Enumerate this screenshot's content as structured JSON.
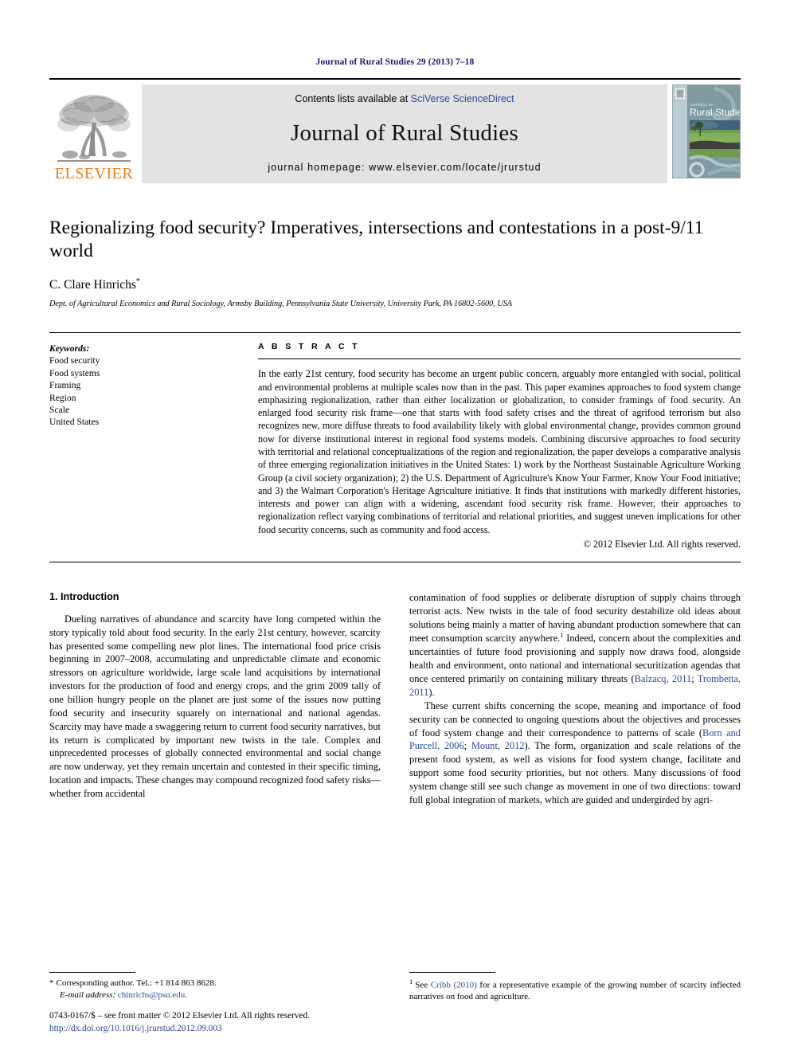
{
  "running_head": "Journal of Rural Studies 29 (2013) 7–18",
  "banner": {
    "publisher_name": "ELSEVIER",
    "contents_prefix": "Contents lists available at ",
    "contents_link": "SciVerse ScienceDirect",
    "journal_title": "Journal of Rural Studies",
    "homepage": "journal homepage: www.elsevier.com/locate/jrurstud",
    "cover": {
      "kicker": "JOURNAL OF",
      "title": "Rural Studies"
    },
    "colors": {
      "elsevier_orange": "#f07d20",
      "link_blue": "#2b4a9b",
      "panel_gray": "#e3e3e3",
      "cover_teal": "#6f8d94"
    }
  },
  "article": {
    "title": "Regionalizing food security? Imperatives, intersections and contestations in a post-9/11 world",
    "author": "C. Clare Hinrichs",
    "author_marker": "*",
    "affiliation": "Dept. of Agricultural Economics and Rural Sociology, Armsby Building, Pennsylvania State University, University Park, PA 16802-5600, USA"
  },
  "keywords": {
    "heading": "Keywords:",
    "items": [
      "Food security",
      "Food systems",
      "Framing",
      "Region",
      "Scale",
      "United States"
    ]
  },
  "abstract": {
    "heading": "A B S T R A C T",
    "text": "In the early 21st century, food security has become an urgent public concern, arguably more entangled with social, political and environmental problems at multiple scales now than in the past. This paper examines approaches to food system change emphasizing regionalization, rather than either localization or globalization, to consider framings of food security. An enlarged food security risk frame—one that starts with food safety crises and the threat of agrifood terrorism but also recognizes new, more diffuse threats to food availability likely with global environmental change, provides common ground now for diverse institutional interest in regional food systems models. Combining discursive approaches to food security with territorial and relational conceptualizations of the region and regionalization, the paper develops a comparative analysis of three emerging regionalization initiatives in the United States: 1) work by the Northeast Sustainable Agriculture Working Group (a civil society organization); 2) the U.S. Department of Agriculture's Know Your Farmer, Know Your Food initiative; and 3) the Walmart Corporation's Heritage Agriculture initiative. It finds that institutions with markedly different histories, interests and power can align with a widening, ascendant food security risk frame. However, their approaches to regionalization reflect varying combinations of territorial and relational priorities, and suggest uneven implications for other food security concerns, such as community and food access.",
    "copyright": "© 2012 Elsevier Ltd. All rights reserved."
  },
  "body": {
    "section_heading": "1. Introduction",
    "left_paragraph_1": "Dueling narratives of abundance and scarcity have long competed within the story typically told about food security. In the early 21st century, however, scarcity has presented some compelling new plot lines. The international food price crisis beginning in 2007–2008, accumulating and unpredictable climate and economic stressors on agriculture worldwide, large scale land acquisitions by international investors for the production of food and energy crops, and the grim 2009 tally of one billion hungry people on the planet are just some of the issues now putting food security and insecurity squarely on international and national agendas. Scarcity may have made a swaggering return to current food security narratives, but its return is complicated by important new twists in the tale. Complex and unprecedented processes of globally connected environmental and social change are now underway, yet they remain uncertain and contested in their specific timing, location and impacts. These changes may compound recognized food safety risks—whether from accidental",
    "right_paragraph_1_a": "contamination of food supplies or deliberate disruption of supply chains through terrorist acts. New twists in the tale of food security destabilize old ideas about solutions being mainly a matter of having abundant production somewhere that can meet consumption scarcity anywhere.",
    "right_paragraph_1_footnote_marker": "1",
    "right_paragraph_1_b": " Indeed, concern about the complexities and uncertainties of future food provisioning and supply now draws food, alongside health and environment, onto national and international securitization agendas that once centered primarily on containing military threats (",
    "right_paragraph_1_cite_1": "Balzacq, 2011",
    "right_paragraph_1_sep": "; ",
    "right_paragraph_1_cite_2": "Trombetta, 2011",
    "right_paragraph_1_c": ").",
    "right_paragraph_2_a": "These current shifts concerning the scope, meaning and importance of food security can be connected to ongoing questions about the objectives and processes of food system change and their correspondence to patterns of scale (",
    "right_paragraph_2_cite_1": "Born and Purcell, 2006",
    "right_paragraph_2_sep": "; ",
    "right_paragraph_2_cite_2": "Mount, 2012",
    "right_paragraph_2_b": "). The form, organization and scale relations of the present food system, as well as visions for food system change, facilitate and support some food security priorities, but not others. Many discussions of food system change still see such change as movement in one of two directions: toward full global integration of markets, which are guided and undergirded by agri-"
  },
  "footnotes": {
    "corresponding": {
      "marker": "*",
      "text": "Corresponding author. Tel.: +1 814 863 8628.",
      "email_label": "E-mail address:",
      "email": "chinrichs@psu.edu."
    },
    "footnote_1": {
      "marker": "1",
      "prefix": "See ",
      "cite": "Cribb (2010)",
      "suffix": " for a representative example of the growing number of scarcity inflected narratives on food and agriculture."
    }
  },
  "imprint": {
    "issn_line": "0743-0167/$ – see front matter © 2012 Elsevier Ltd. All rights reserved.",
    "doi": "http://dx.doi.org/10.1016/j.jrurstud.2012.09.003"
  }
}
